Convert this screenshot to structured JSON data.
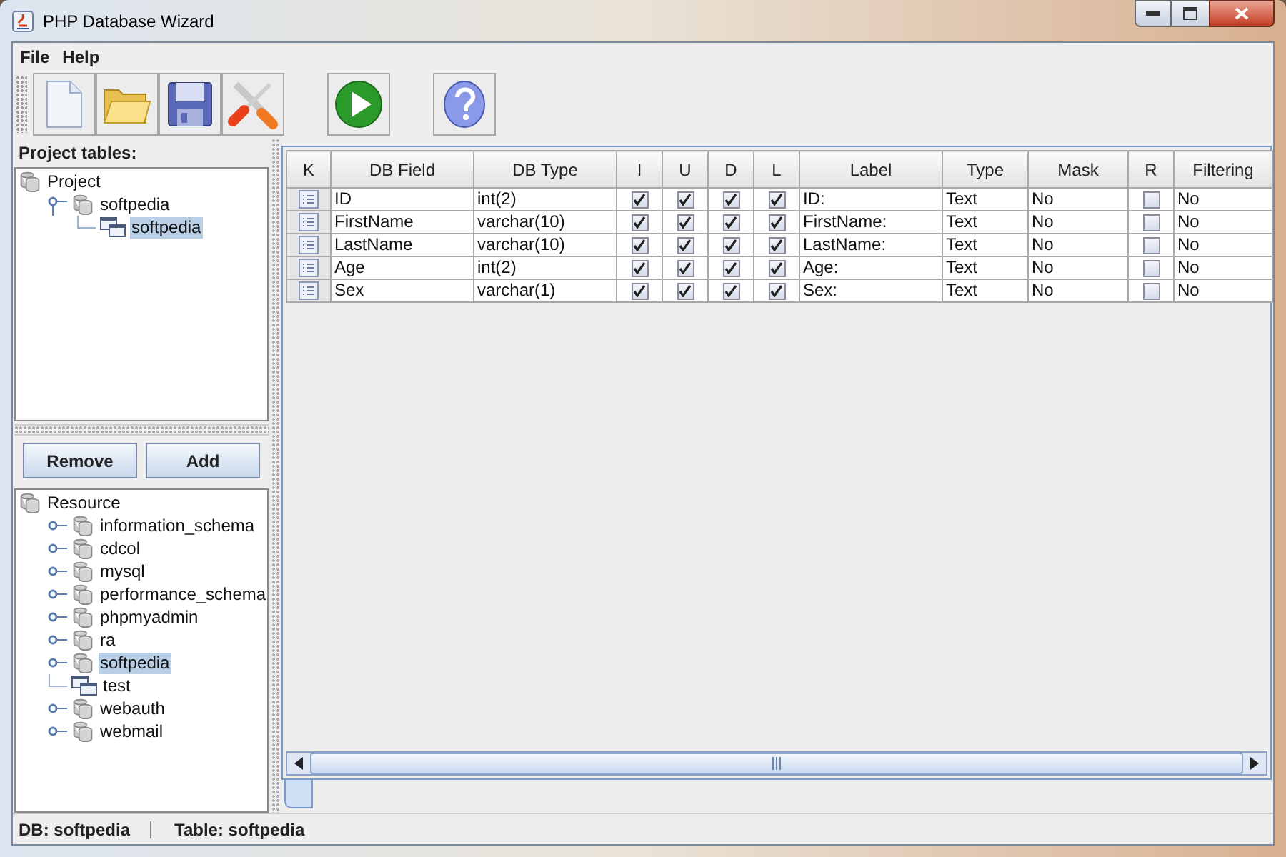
{
  "window": {
    "title": "PHP Database Wizard"
  },
  "menu": [
    "File",
    "Help"
  ],
  "toolbar": [
    {
      "kind": "new"
    },
    {
      "kind": "open"
    },
    {
      "kind": "save"
    },
    {
      "kind": "tools"
    },
    {
      "kind": "run"
    },
    {
      "kind": "help"
    }
  ],
  "project_tables": {
    "title": "Project tables:",
    "tree": [
      {
        "label": "Project",
        "kind": "database",
        "selected": false,
        "children": [
          {
            "label": "softpedia",
            "kind": "database",
            "selected": false,
            "expanded": true,
            "children": [
              {
                "label": "softpedia",
                "kind": "table",
                "selected": true
              }
            ]
          }
        ]
      }
    ]
  },
  "buttons": [
    "Remove",
    "Add"
  ],
  "resources": {
    "tree": [
      {
        "label": "Resource",
        "kind": "database",
        "selected": false,
        "children": [
          {
            "label": "information_schema",
            "kind": "database",
            "selected": false,
            "expanded": false
          },
          {
            "label": "cdcol",
            "kind": "database",
            "selected": false,
            "expanded": false
          },
          {
            "label": "mysql",
            "kind": "database",
            "selected": false,
            "expanded": false
          },
          {
            "label": "performance_schema",
            "kind": "database",
            "selected": false,
            "expanded": false
          },
          {
            "label": "phpmyadmin",
            "kind": "database",
            "selected": false,
            "expanded": false
          },
          {
            "label": "ra",
            "kind": "database",
            "selected": false,
            "expanded": false
          },
          {
            "label": "softpedia",
            "kind": "database",
            "selected": true,
            "expanded": false
          },
          {
            "label": "test",
            "kind": "table",
            "selected": false
          },
          {
            "label": "webauth",
            "kind": "database",
            "selected": false,
            "expanded": false
          },
          {
            "label": "webmail",
            "kind": "database",
            "selected": false,
            "expanded": false
          }
        ]
      }
    ]
  },
  "table": {
    "columns": [
      "K",
      "DB Field",
      "DB Type",
      "I",
      "U",
      "D",
      "L",
      "Label",
      "Type",
      "Mask",
      "R",
      "Filtering"
    ],
    "rows": [
      {
        "db_field": "ID",
        "db_type": "int(2)",
        "i": true,
        "u": true,
        "d": true,
        "l": true,
        "label": "ID:",
        "type": "Text",
        "mask": "No",
        "r": false,
        "filtering": "No"
      },
      {
        "db_field": "FirstName",
        "db_type": "varchar(10)",
        "i": true,
        "u": true,
        "d": true,
        "l": true,
        "label": "FirstName:",
        "type": "Text",
        "mask": "No",
        "r": false,
        "filtering": "No"
      },
      {
        "db_field": "LastName",
        "db_type": "varchar(10)",
        "i": true,
        "u": true,
        "d": true,
        "l": true,
        "label": "LastName:",
        "type": "Text",
        "mask": "No",
        "r": false,
        "filtering": "No"
      },
      {
        "db_field": "Age",
        "db_type": "int(2)",
        "i": true,
        "u": true,
        "d": true,
        "l": true,
        "label": "Age:",
        "type": "Text",
        "mask": "No",
        "r": false,
        "filtering": "No"
      },
      {
        "db_field": "Sex",
        "db_type": "varchar(1)",
        "i": true,
        "u": true,
        "d": true,
        "l": true,
        "label": "Sex:",
        "type": "Text",
        "mask": "No",
        "r": false,
        "filtering": "No"
      }
    ]
  },
  "status_bar": [
    "DB: softpedia",
    "Table: softpedia"
  ]
}
